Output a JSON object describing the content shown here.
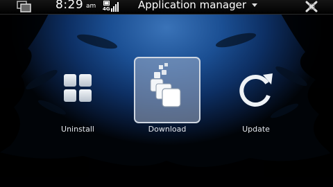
{
  "status_bar": {
    "time": "8:29",
    "ampm": "am",
    "network": "4G",
    "title": "Application manager"
  },
  "launchers": [
    {
      "id": "uninstall",
      "label": "Uninstall",
      "icon": "grid-icon",
      "selected": false
    },
    {
      "id": "download",
      "label": "Download",
      "icon": "stacked-squares-icon",
      "selected": true
    },
    {
      "id": "update",
      "label": "Update",
      "icon": "refresh-icon",
      "selected": false
    }
  ],
  "colors": {
    "background_glow": "#3a73b8",
    "selection": "#cfd7e2",
    "statusbar": "#000000"
  }
}
